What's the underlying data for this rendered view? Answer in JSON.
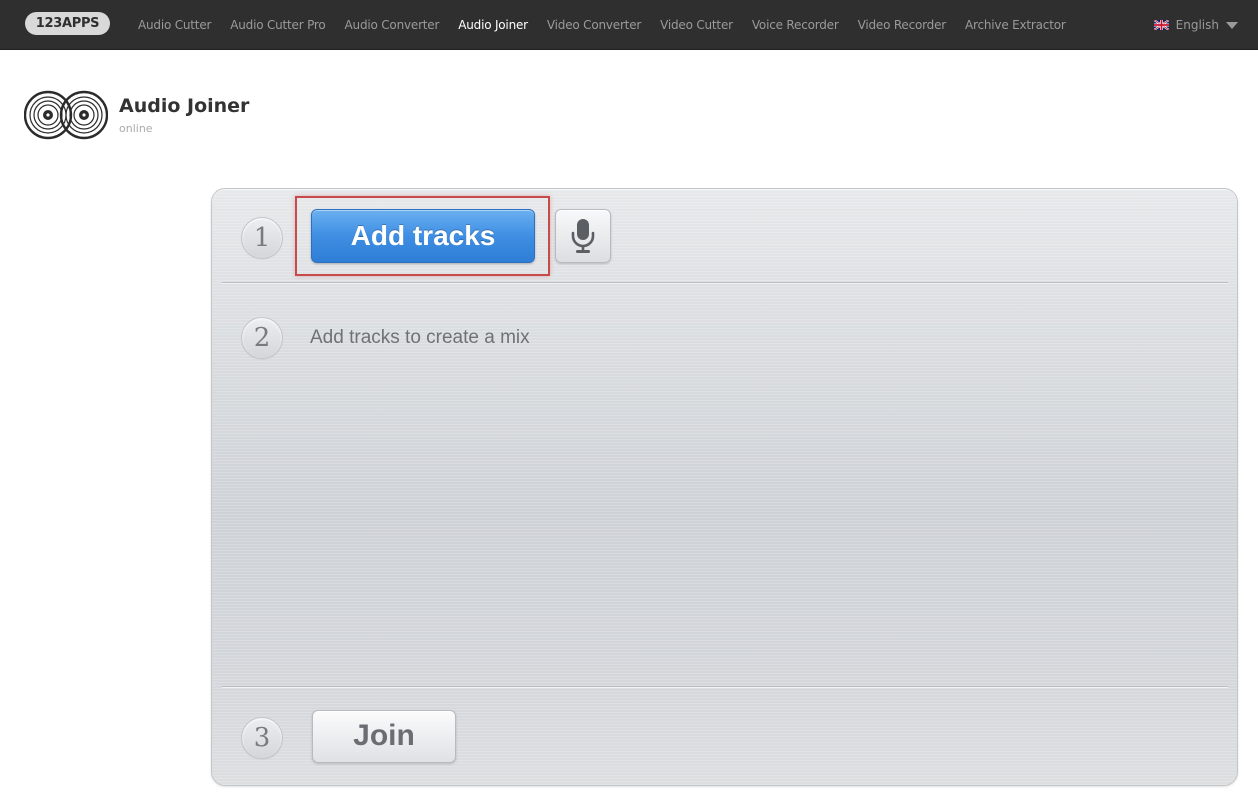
{
  "nav": {
    "brand": "123APPS",
    "items": [
      {
        "label": "Audio Cutter",
        "active": false
      },
      {
        "label": "Audio Cutter Pro",
        "active": false
      },
      {
        "label": "Audio Converter",
        "active": false
      },
      {
        "label": "Audio Joiner",
        "active": true
      },
      {
        "label": "Video Converter",
        "active": false
      },
      {
        "label": "Video Cutter",
        "active": false
      },
      {
        "label": "Voice Recorder",
        "active": false
      },
      {
        "label": "Video Recorder",
        "active": false
      },
      {
        "label": "Archive Extractor",
        "active": false
      }
    ],
    "language": "English",
    "language_icon": "uk-flag-icon"
  },
  "header": {
    "title": "Audio Joiner",
    "subtitle": "online",
    "logo_icon": "vinyl-records-icon"
  },
  "steps": [
    {
      "number": "1",
      "button_label": "Add tracks",
      "mic_icon": "microphone-icon"
    },
    {
      "number": "2",
      "hint": "Add tracks to create a mix"
    },
    {
      "number": "3",
      "button_label": "Join"
    }
  ],
  "colors": {
    "topbar": "#2f2f2f",
    "accent_blue": "#3e8ee3",
    "highlight": "#c84b4b"
  }
}
